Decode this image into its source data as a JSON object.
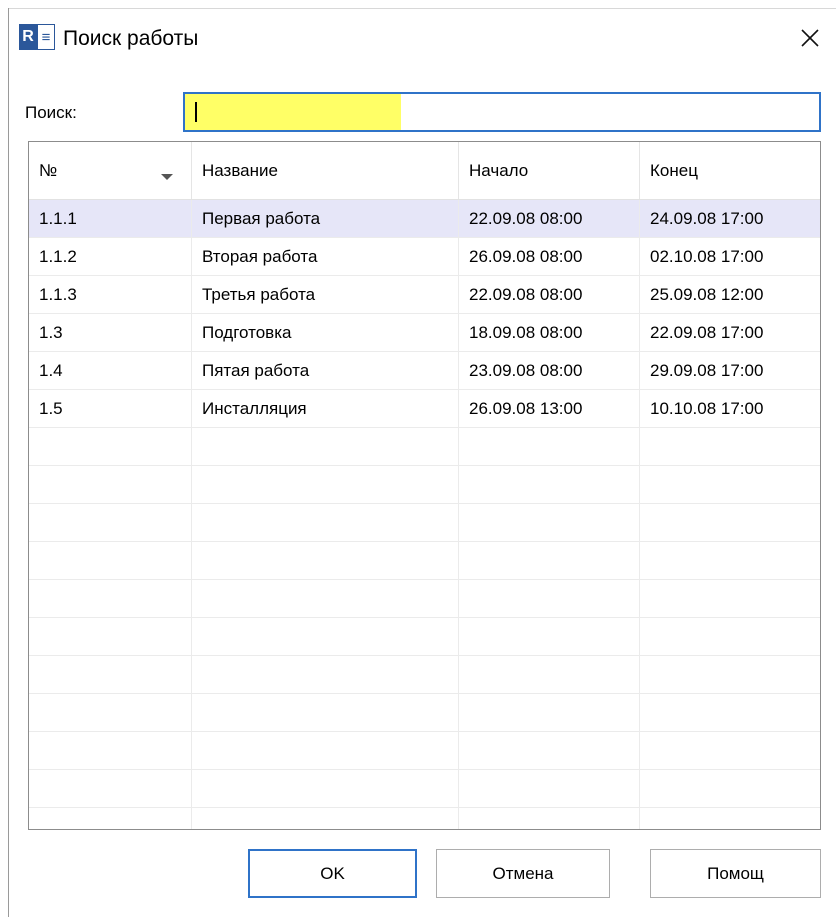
{
  "window": {
    "title": "Поиск работы",
    "icon": "project-document-icon"
  },
  "search": {
    "label": "Поиск:",
    "value": "",
    "placeholder": ""
  },
  "table": {
    "columns": [
      "№",
      "Название",
      "Начало",
      "Конец"
    ],
    "sorted_column": "№",
    "rows": [
      [
        "1.1.1",
        "Первая работа",
        "22.09.08 08:00",
        "24.09.08 17:00"
      ],
      [
        "1.1.2",
        "Вторая работа",
        "26.09.08 08:00",
        "02.10.08 17:00"
      ],
      [
        "1.1.3",
        "Третья работа",
        "22.09.08 08:00",
        "25.09.08 12:00"
      ],
      [
        "1.3",
        "Подготовка",
        "18.09.08 08:00",
        "22.09.08 17:00"
      ],
      [
        "1.4",
        "Пятая работа",
        "23.09.08 08:00",
        "29.09.08 17:00"
      ],
      [
        "1.5",
        "Инсталляция",
        "26.09.08 13:00",
        "10.10.08 17:00"
      ]
    ],
    "selected_row": 0,
    "empty_rows": 11
  },
  "buttons": {
    "ok": "OK",
    "cancel": "Отмена",
    "help": "Помощ"
  },
  "colors": {
    "accent": "#2f73c8",
    "search_highlight": "#ffff66",
    "selected_row": "#e6e6f8"
  }
}
